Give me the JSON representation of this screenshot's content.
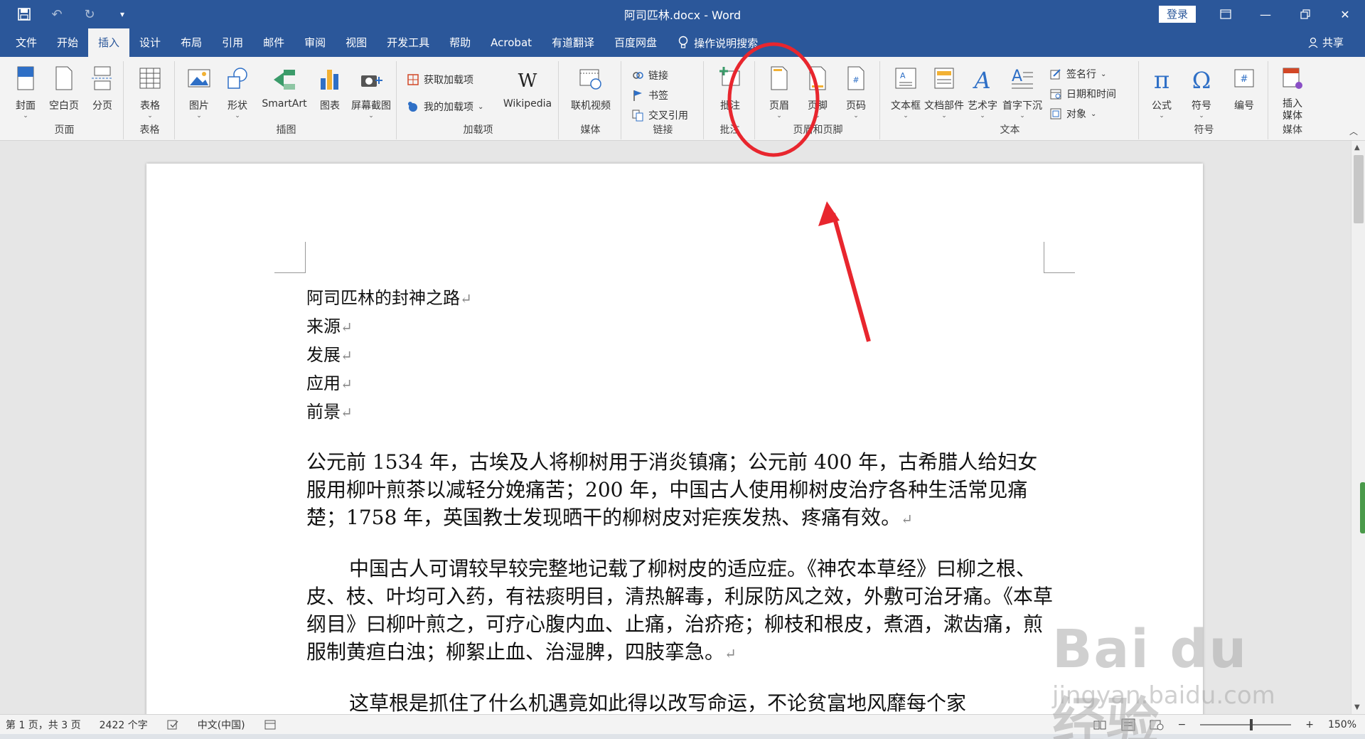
{
  "window": {
    "title": "阿司匹林.docx  -  Word",
    "login_label": "登录"
  },
  "tabs": [
    {
      "label": "文件"
    },
    {
      "label": "开始"
    },
    {
      "label": "插入"
    },
    {
      "label": "设计"
    },
    {
      "label": "布局"
    },
    {
      "label": "引用"
    },
    {
      "label": "邮件"
    },
    {
      "label": "审阅"
    },
    {
      "label": "视图"
    },
    {
      "label": "开发工具"
    },
    {
      "label": "帮助"
    },
    {
      "label": "Acrobat"
    },
    {
      "label": "有道翻译"
    },
    {
      "label": "百度网盘"
    }
  ],
  "active_tab": "插入",
  "tell_me": "操作说明搜索",
  "share_label": "共享",
  "ribbon": {
    "pages": {
      "label": "页面",
      "cover": "封面",
      "blank": "空白页",
      "break": "分页"
    },
    "tables": {
      "label": "表格",
      "table": "表格"
    },
    "illustrations": {
      "label": "插图",
      "picture": "图片",
      "shapes": "形状",
      "smartart": "SmartArt",
      "chart": "图表",
      "screenshot": "屏幕截图"
    },
    "addins": {
      "label": "加载项",
      "get": "获取加载项",
      "mine": "我的加载项",
      "wikipedia": "Wikipedia"
    },
    "media": {
      "label": "媒体",
      "video": "联机视频"
    },
    "links": {
      "label": "链接",
      "link": "链接",
      "bookmark": "书签",
      "crossref": "交叉引用"
    },
    "comments": {
      "label": "批注",
      "comment": "批注"
    },
    "header_footer": {
      "label": "页眉和页脚",
      "header": "页眉",
      "footer": "页脚",
      "page_number": "页码"
    },
    "text": {
      "label": "文本",
      "textbox": "文本框",
      "quickparts": "文档部件",
      "wordart": "艺术字",
      "dropcap": "首字下沉",
      "signature": "签名行",
      "datetime": "日期和时间",
      "object": "对象"
    },
    "symbols": {
      "label": "符号",
      "equation": "公式",
      "symbol": "符号",
      "number": "编号"
    },
    "embed_media": {
      "label": "媒体",
      "insert_media": "插入\n媒体"
    }
  },
  "document": {
    "headings": [
      "阿司匹林的封神之路",
      "来源",
      "发展",
      "应用",
      "前景"
    ],
    "paragraphs": [
      "公元前 1534 年，古埃及人将柳树用于消炎镇痛；公元前 400 年，古希腊人给妇女服用柳叶煎茶以减轻分娩痛苦；200 年，中国古人使用柳树皮治疗各种生活常见痛楚；1758 年，英国教士发现晒干的柳树皮对疟疾发热、疼痛有效。",
      "中国古人可谓较早较完整地记载了柳树皮的适应症。《神农本草经》曰柳之根、皮、枝、叶均可入药，有祛痰明目，清热解毒，利尿防风之效，外敷可治牙痛。《本草纲目》曰柳叶煎之，可疗心腹内血、止痛，治疥疮；柳枝和根皮，煮酒，漱齿痛，煎服制黄疸白浊；柳絮止血、治湿脾，四肢挛急。",
      "这草根是抓住了什么机遇竟如此得以改写命运，不论贫富地风靡每个家"
    ]
  },
  "status": {
    "page": "第 1 页，共 3 页",
    "words": "2422 个字",
    "language": "中文(中国)",
    "zoom": "150%"
  },
  "watermark": {
    "brand": "Bai du 经验",
    "url": "jingyan.baidu.com"
  },
  "colors": {
    "accent": "#2b579a",
    "annotation": "#e8262e"
  }
}
